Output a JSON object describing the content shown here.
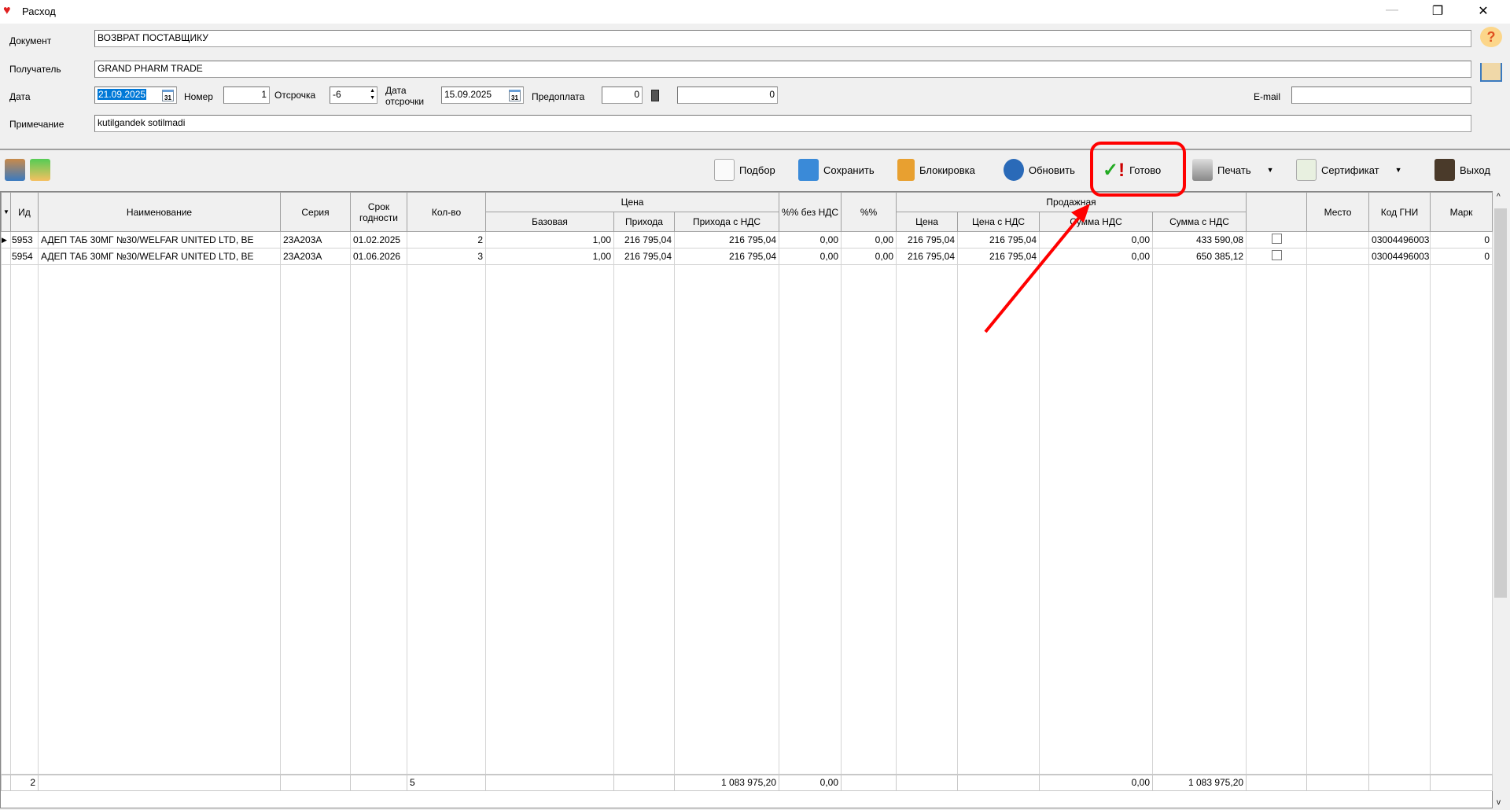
{
  "window": {
    "title": "Расход",
    "minimize": "—",
    "restore": "❐",
    "close": "✕"
  },
  "form": {
    "document_label": "Документ",
    "document_value": "ВОЗВРАТ ПОСТАВЩИКУ",
    "recipient_label": "Получатель",
    "recipient_value": "GRAND PHARM TRADE",
    "date_label": "Дата",
    "date_value": "21.09.2025",
    "number_label": "Номер",
    "number_value": "1",
    "delay_label": "Отсрочка",
    "delay_value": "-6",
    "delay_date_label": "Дата отсрочки",
    "delay_date_value": "15.09.2025",
    "prepay_label": "Предоплата",
    "prepay_value": "0",
    "extra_value": "0",
    "email_label": "E-mail",
    "email_value": "",
    "note_label": "Примечание",
    "note_value": "kutilgandek sotilmadi",
    "calendar_day": "31"
  },
  "toolbar": {
    "select": "Подбор",
    "save": "Сохранить",
    "lock": "Блокировка",
    "refresh": "Обновить",
    "done": "Готово",
    "print": "Печать",
    "certificate": "Сертификат",
    "exit": "Выход",
    "dropdown": "▼"
  },
  "grid": {
    "headers": {
      "id": "Ид",
      "name": "Наименование",
      "series": "Серия",
      "expiry": "Срок годности",
      "qty": "Кол-во",
      "price": "Цена",
      "base": "Базовая",
      "incoming": "Приход​а",
      "incoming_vat": "Прихода с НДС",
      "pct_no_vat": "%% без НДС",
      "pct": "%%",
      "sale": "Продажная",
      "sale_price": "Цена",
      "sale_price_vat": "Цена с НДС",
      "vat_sum": "Сумма НДС",
      "sum_vat": "Сумма с НДС",
      "place": "Место",
      "gni_code": "Код ГНИ",
      "mark": "Марк"
    },
    "rows": [
      {
        "id": "5953",
        "name": "АДЕП ТАБ 30МГ №30/WELFAR UNITED LTD, BE",
        "series": "23A203A",
        "expiry": "01.02.2025",
        "qty": "2",
        "base": "1,00",
        "incoming": "216 795,04",
        "incoming_vat": "216 795,04",
        "pct_no_vat": "0,00",
        "pct": "0,00",
        "sale_price": "216 795,04",
        "sale_price_vat": "216 795,04",
        "vat_sum": "0,00",
        "sum_vat": "433 590,08",
        "checked": false,
        "place": "",
        "gni_code": "03004496003",
        "mark": "0",
        "current": true
      },
      {
        "id": "5954",
        "name": "АДЕП ТАБ 30МГ №30/WELFAR UNITED LTD, BE",
        "series": "23A203A",
        "expiry": "01.06.2026",
        "qty": "3",
        "base": "1,00",
        "incoming": "216 795,04",
        "incoming_vat": "216 795,04",
        "pct_no_vat": "0,00",
        "pct": "0,00",
        "sale_price": "216 795,04",
        "sale_price_vat": "216 795,04",
        "vat_sum": "0,00",
        "sum_vat": "650 385,12",
        "checked": false,
        "place": "",
        "gni_code": "03004496003",
        "mark": "0",
        "current": false
      }
    ],
    "footer": {
      "count": "2",
      "qty": "5",
      "incoming_vat": "1 083 975,20",
      "pct_no_vat": "0,00",
      "vat_sum": "0,00",
      "sum_vat": "1 083 975,20"
    }
  },
  "annotation": {
    "color": "#ff0000",
    "highlight": "done-button"
  }
}
